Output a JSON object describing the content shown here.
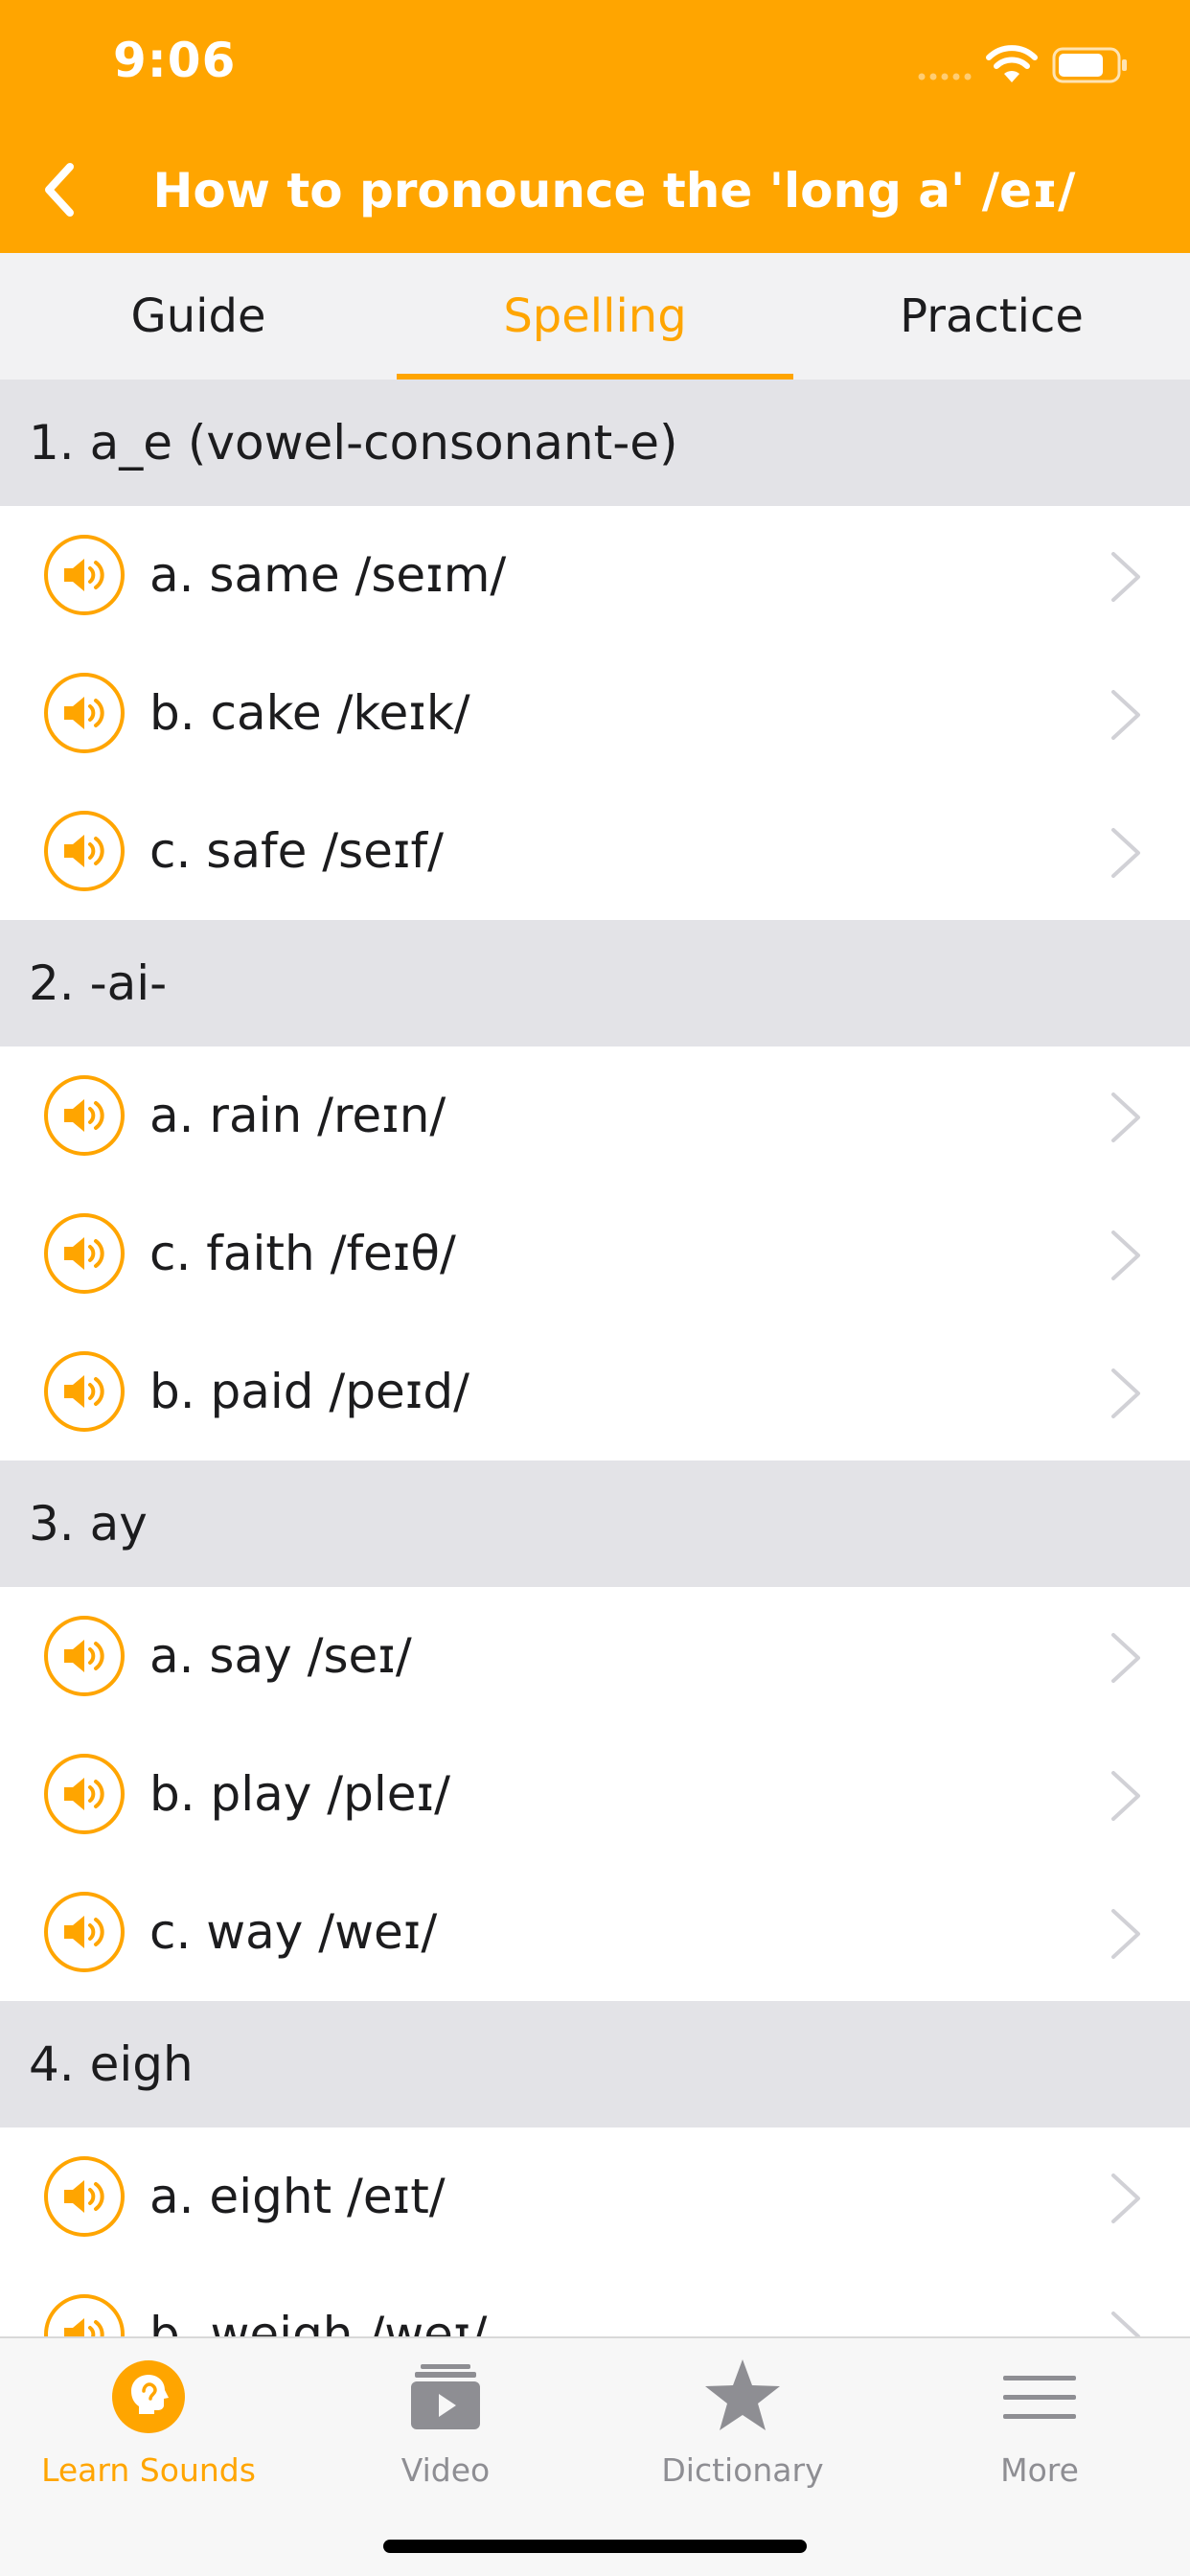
{
  "status_bar": {
    "time": "9:06"
  },
  "nav": {
    "title": "How to pronounce the 'long a' /eɪ/",
    "back_icon": "chevron-left-icon"
  },
  "tabs": [
    {
      "label": "Guide",
      "active": false
    },
    {
      "label": "Spelling",
      "active": true
    },
    {
      "label": "Practice",
      "active": false
    }
  ],
  "sections": [
    {
      "title": "1. a_e (vowel-consonant-e)",
      "items": [
        {
          "label": "a. same /seɪm/"
        },
        {
          "label": "b. cake /keɪk/"
        },
        {
          "label": "c. safe /seɪf/"
        }
      ]
    },
    {
      "title": "2. -ai-",
      "items": [
        {
          "label": "a. rain /reɪn/"
        },
        {
          "label": "c. faith /feɪθ/"
        },
        {
          "label": "b. paid /peɪd/"
        }
      ]
    },
    {
      "title": "3. ay",
      "items": [
        {
          "label": "a. say /seɪ/"
        },
        {
          "label": "b. play /pleɪ/"
        },
        {
          "label": "c. way /weɪ/"
        }
      ]
    },
    {
      "title": "4. eigh",
      "items": [
        {
          "label": "a. eight /eɪt/"
        },
        {
          "label": "b. weigh /weɪ/"
        }
      ]
    }
  ],
  "tab_bar": [
    {
      "label": "Learn Sounds",
      "icon": "head-icon",
      "active": true
    },
    {
      "label": "Video",
      "icon": "video-icon",
      "active": false
    },
    {
      "label": "Dictionary",
      "icon": "star-icon",
      "active": false
    },
    {
      "label": "More",
      "icon": "menu-icon",
      "active": false
    }
  ],
  "colors": {
    "accent": "#FFA500",
    "section_bg": "#e3e3e7",
    "tab_bg": "#f2f2f3",
    "inactive": "#8e8e93"
  }
}
